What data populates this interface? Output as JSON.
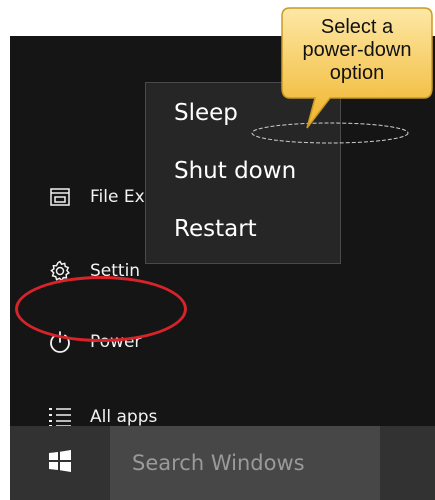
{
  "start_menu": {
    "items": [
      {
        "label": "File Ex",
        "icon": "file-explorer-icon"
      },
      {
        "label": "Settin",
        "icon": "gear-icon"
      },
      {
        "label": "Power",
        "icon": "power-icon"
      },
      {
        "label": "All apps",
        "icon": "list-icon"
      }
    ]
  },
  "power_menu": {
    "options": [
      {
        "label": "Sleep"
      },
      {
        "label": "Shut down"
      },
      {
        "label": "Restart"
      }
    ]
  },
  "taskbar": {
    "start_icon": "windows-logo-icon",
    "search_placeholder": "Search Windows"
  },
  "annotation": {
    "callout_lines": [
      "Select a",
      "power-down",
      "option"
    ],
    "callout_color": "#f5c242",
    "highlight_color": "#d7232a"
  },
  "colors": {
    "panel_background": "#151515",
    "flyout_background": "#262626",
    "taskbar_background": "#323232",
    "search_background": "#474747"
  }
}
